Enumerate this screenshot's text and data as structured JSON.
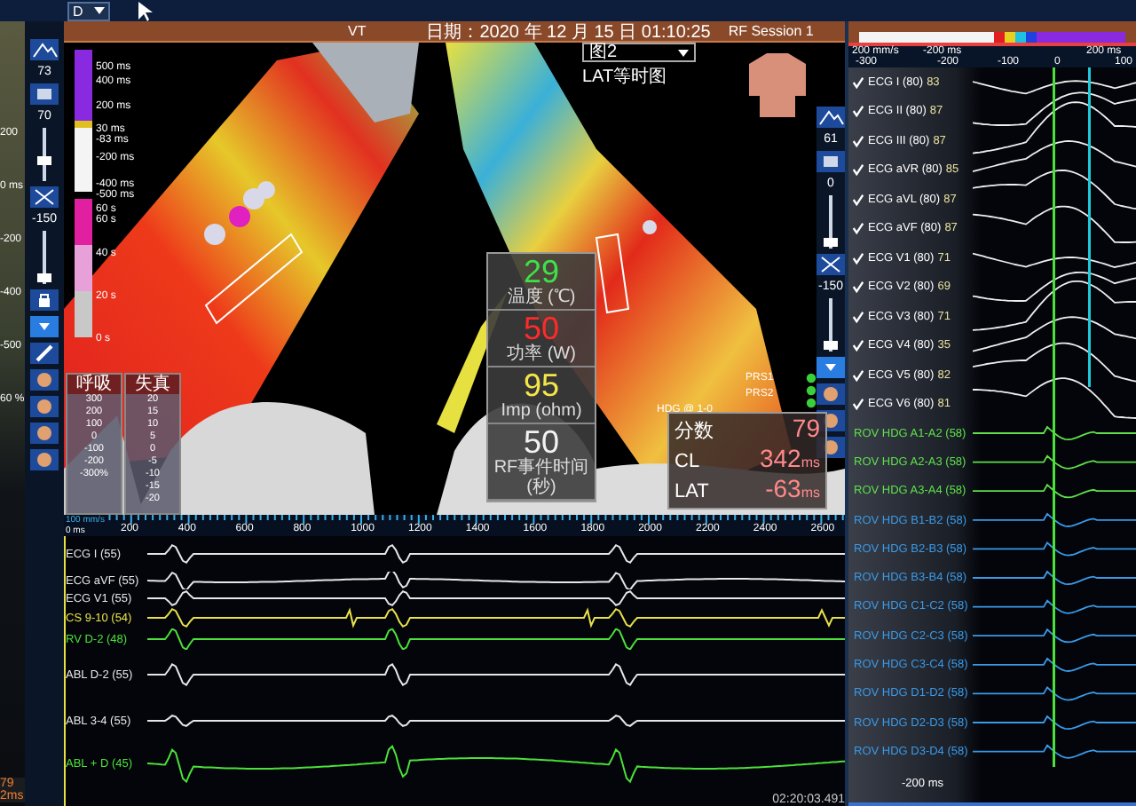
{
  "top_bar": {
    "dropdown": "D"
  },
  "left_panel": {
    "labels": [
      "200",
      "0 ms",
      "-200",
      "-400",
      "-500",
      "60 %"
    ],
    "readouts": [
      "79",
      "2ms"
    ]
  },
  "left_toolbar": {
    "values": [
      "73",
      "70",
      "-150"
    ]
  },
  "header": {
    "title": "VT",
    "date": "日期：2020 年 12 月 15 日 01:10:25",
    "session": "RF Session 1"
  },
  "map": {
    "view_select": "图2",
    "map_type": "LAT等时图",
    "lat_scale": [
      "500 ms",
      "400 ms",
      "200 ms",
      "30 ms",
      "-83 ms",
      "-200 ms",
      "-400 ms",
      "-500 ms"
    ],
    "time_scale": [
      "60 s",
      "60 s",
      "40 s",
      "20 s",
      "0 s"
    ],
    "respiration": {
      "title": "呼吸",
      "ticks": [
        "300",
        "200",
        "100",
        "0",
        "-100",
        "-200",
        "-300%"
      ]
    },
    "distortion": {
      "title": "失真",
      "ticks": [
        "20",
        "15",
        "10",
        "5",
        "0",
        "-5",
        "-10",
        "-15",
        "-20"
      ]
    },
    "point_labels": [
      "PRS1",
      "PRS2",
      "HDG @ 1-0"
    ],
    "toolbar_values": [
      "61",
      "0",
      "-150"
    ]
  },
  "ablation": [
    {
      "value": "29",
      "label": "温度 (℃)",
      "color": "#3fe04a"
    },
    {
      "value": "50",
      "label": "功率 (W)",
      "color": "#ff2a2a"
    },
    {
      "value": "95",
      "label": "Imp (ohm)",
      "color": "#f4e64a"
    },
    {
      "value": "50",
      "label": "RF事件时间 (秒)",
      "color": "#f2f2f2"
    }
  ],
  "point_info": [
    {
      "label": "分数",
      "value": "79"
    },
    {
      "label": "CL",
      "value": "342",
      "unit": "ms"
    },
    {
      "label": "LAT",
      "value": "-63",
      "unit": "ms"
    }
  ],
  "ruler": {
    "speed": "100 mm/s",
    "origin": "0 ms",
    "ticks": [
      "200",
      "400",
      "600",
      "800",
      "1000",
      "1200",
      "1400",
      "1600",
      "1800",
      "2000",
      "2200",
      "2400",
      "2600"
    ]
  },
  "traces": [
    {
      "label": "ECG I (55)",
      "color": "#e6e6e6"
    },
    {
      "label": "ECG aVF (55)",
      "color": "#e6e6e6"
    },
    {
      "label": "ECG V1 (55)",
      "color": "#e6e6e6"
    },
    {
      "label": "CS 9-10 (54)",
      "color": "#e8e04a"
    },
    {
      "label": "RV D-2 (48)",
      "color": "#4be03a"
    },
    {
      "label": "ABL D-2 (55)",
      "color": "#e6e6e6"
    },
    {
      "label": "ABL 3-4 (55)",
      "color": "#e6e6e6"
    },
    {
      "label": "ABL + D (45)",
      "color": "#4be03a"
    }
  ],
  "timestamp": "02:20:03.491",
  "right_panel": {
    "ruler_top": [
      "200 mm/s",
      "-200 ms",
      "200 ms"
    ],
    "ruler_ticks": [
      "-300",
      "-200",
      "-100",
      "0",
      "100"
    ],
    "ecg": [
      {
        "label": "ECG I (80)",
        "value": "83",
        "checked": true
      },
      {
        "label": "ECG II (80)",
        "value": "87",
        "checked": true
      },
      {
        "label": "ECG III (80)",
        "value": "87",
        "checked": true
      },
      {
        "label": "ECG aVR (80)",
        "value": "85",
        "checked": true
      },
      {
        "label": "ECG aVL (80)",
        "value": "87",
        "checked": true
      },
      {
        "label": "ECG aVF (80)",
        "value": "87",
        "checked": true
      },
      {
        "label": "ECG V1 (80)",
        "value": "71",
        "checked": true
      },
      {
        "label": "ECG V2 (80)",
        "value": "69",
        "checked": true
      },
      {
        "label": "ECG V3 (80)",
        "value": "71",
        "checked": true
      },
      {
        "label": "ECG V4 (80)",
        "value": "35",
        "checked": true
      },
      {
        "label": "ECG V5 (80)",
        "value": "82",
        "checked": true
      },
      {
        "label": "ECG V6 (80)",
        "value": "81",
        "checked": true
      }
    ],
    "hdg": [
      {
        "label": "ROV HDG A1-A2 (58)",
        "color": "#5ee04a"
      },
      {
        "label": "ROV HDG A2-A3 (58)",
        "color": "#5ee04a"
      },
      {
        "label": "ROV HDG A3-A4 (58)",
        "color": "#5ee04a"
      },
      {
        "label": "ROV HDG B1-B2 (58)",
        "color": "#3a9ae8"
      },
      {
        "label": "ROV HDG B2-B3 (58)",
        "color": "#3a9ae8"
      },
      {
        "label": "ROV HDG B3-B4 (58)",
        "color": "#3a9ae8"
      },
      {
        "label": "ROV HDG C1-C2 (58)",
        "color": "#3a9ae8"
      },
      {
        "label": "ROV HDG C2-C3 (58)",
        "color": "#3a9ae8"
      },
      {
        "label": "ROV HDG C3-C4 (58)",
        "color": "#3a9ae8"
      },
      {
        "label": "ROV HDG D1-D2 (58)",
        "color": "#3a9ae8"
      },
      {
        "label": "ROV HDG D2-D3 (58)",
        "color": "#3a9ae8"
      },
      {
        "label": "ROV HDG D3-D4 (58)",
        "color": "#3a9ae8"
      }
    ],
    "footer": "-200 ms"
  }
}
